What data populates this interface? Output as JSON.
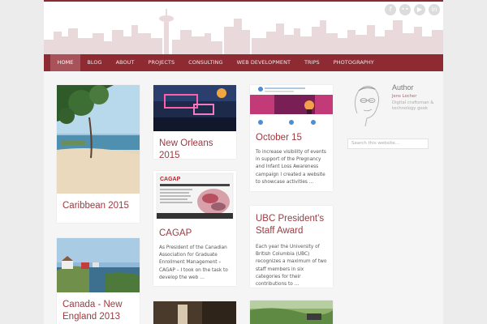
{
  "colors": {
    "brand": "#8e2b32",
    "active_nav": "#a8525a",
    "title": "#9a3a40"
  },
  "social_icons": [
    "facebook-icon",
    "flickr-icon",
    "youtube-icon",
    "linkedin-icon"
  ],
  "social_glyphs": [
    "f",
    "••",
    "▶",
    "in"
  ],
  "nav": [
    {
      "label": "HOME",
      "active": true
    },
    {
      "label": "BLOG"
    },
    {
      "label": "ABOUT"
    },
    {
      "label": "PROJECTS"
    },
    {
      "label": "CONSULTING"
    },
    {
      "label": "WEB DEVELOPMENT"
    },
    {
      "label": "TRIPS"
    },
    {
      "label": "PHOTOGRAPHY"
    }
  ],
  "posts": {
    "caribbean": {
      "title": "Caribbean 2015"
    },
    "canada": {
      "title": "Canada - New England 2013"
    },
    "new_orleans": {
      "title": "New Orleans 2015"
    },
    "cagap": {
      "title": "CAGAP",
      "excerpt": "As President of the Canadian Association for Graduate Enrollment Management – CAGAP – I took on the task to develop the web …",
      "thumb_text": "CAGAP"
    },
    "october": {
      "title": "October 15",
      "excerpt": "To increase visibility of events in support of the Pregnancy and Infant Loss Awareness campaign I created a website to showcase activities …"
    },
    "ubc": {
      "title": "UBC President’s Staff Award",
      "excerpt": "Each year the University of British Columbia (UBC) recognizes a maximum of two staff members in six categories for their contributions to …"
    }
  },
  "sidebar": {
    "author_heading": "Author",
    "author_name": "Jens Locher",
    "author_bio": "Digital craftsman & technology geek",
    "search_placeholder": "Search this website..."
  }
}
